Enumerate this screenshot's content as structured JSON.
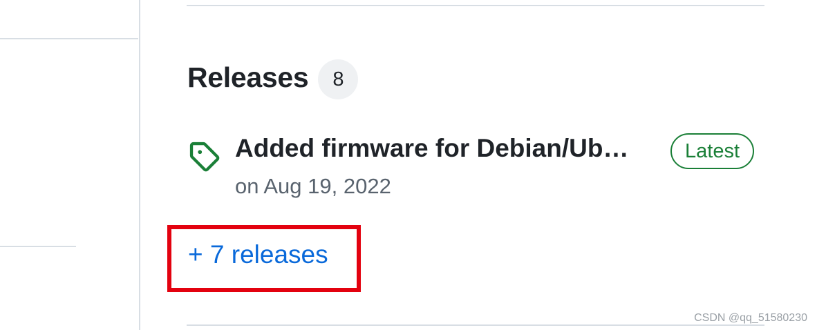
{
  "releases": {
    "title": "Releases",
    "count": "8",
    "latest": {
      "name": "Added firmware for Debian/Ub…",
      "badge": "Latest",
      "date": "on Aug 19, 2022"
    },
    "more_link": "+ 7 releases"
  },
  "icons": {
    "release": "tag-icon"
  },
  "colors": {
    "link": "#0969da",
    "latest_badge": "#1a7f37",
    "highlight": "#e3010f"
  },
  "watermark": "CSDN @qq_51580230"
}
